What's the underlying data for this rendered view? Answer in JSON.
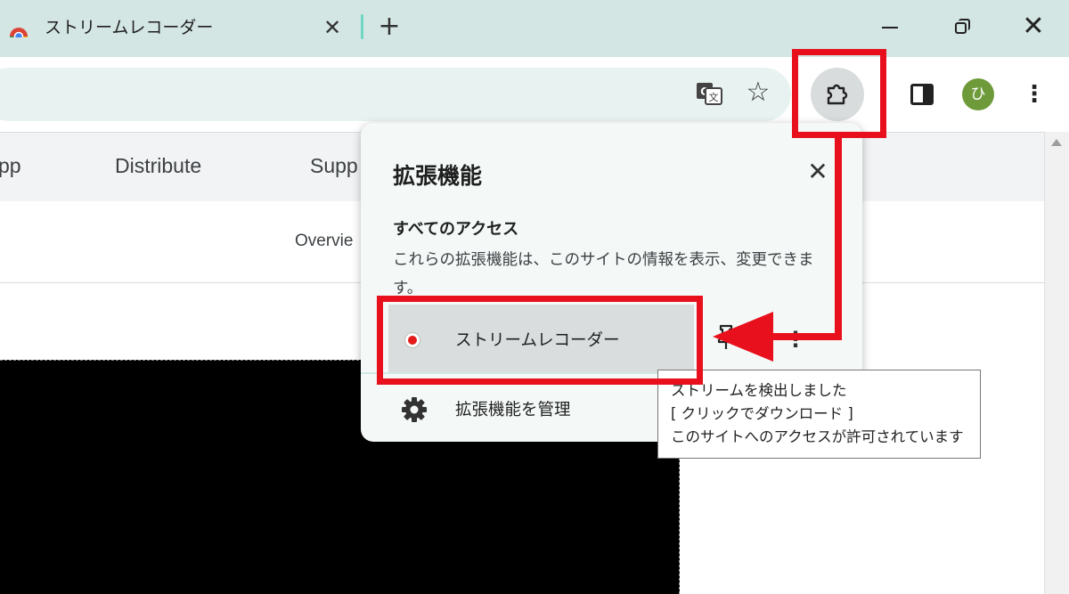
{
  "browser": {
    "tab_title": "ストリームレコーダー",
    "tab_close": "✕",
    "new_tab": "+",
    "window_close": "✕",
    "avatar_initial": "ひ",
    "kebab": "⋮"
  },
  "page": {
    "nav_items": [
      "pp",
      "Distribute",
      "Supp"
    ],
    "subnav_item": "Overvie"
  },
  "popup": {
    "title": "拡張機能",
    "close": "✕",
    "section_title": "すべてのアクセス",
    "section_desc": "これらの拡張機能は、このサイトの情報を表示、変更できます。",
    "extension_name": "ストリームレコーダー",
    "manage_label": "拡張機能を管理",
    "row_kebab": "⋮"
  },
  "tooltip": {
    "lines": [
      "ストリームを検出しました",
      "[ クリックでダウンロード ]",
      "このサイトへのアクセスが許可されています"
    ]
  },
  "colors": {
    "highlight": "#e8101c",
    "accent_tab_separator": "#6fd6c4",
    "avatar": "#6e9a3a"
  },
  "icons": [
    "chrome-favicon-icon",
    "translate-icon",
    "star-icon",
    "extensions-puzzle-icon",
    "side-panel-icon",
    "more-vert-icon",
    "record-icon",
    "pin-icon",
    "gear-icon"
  ]
}
